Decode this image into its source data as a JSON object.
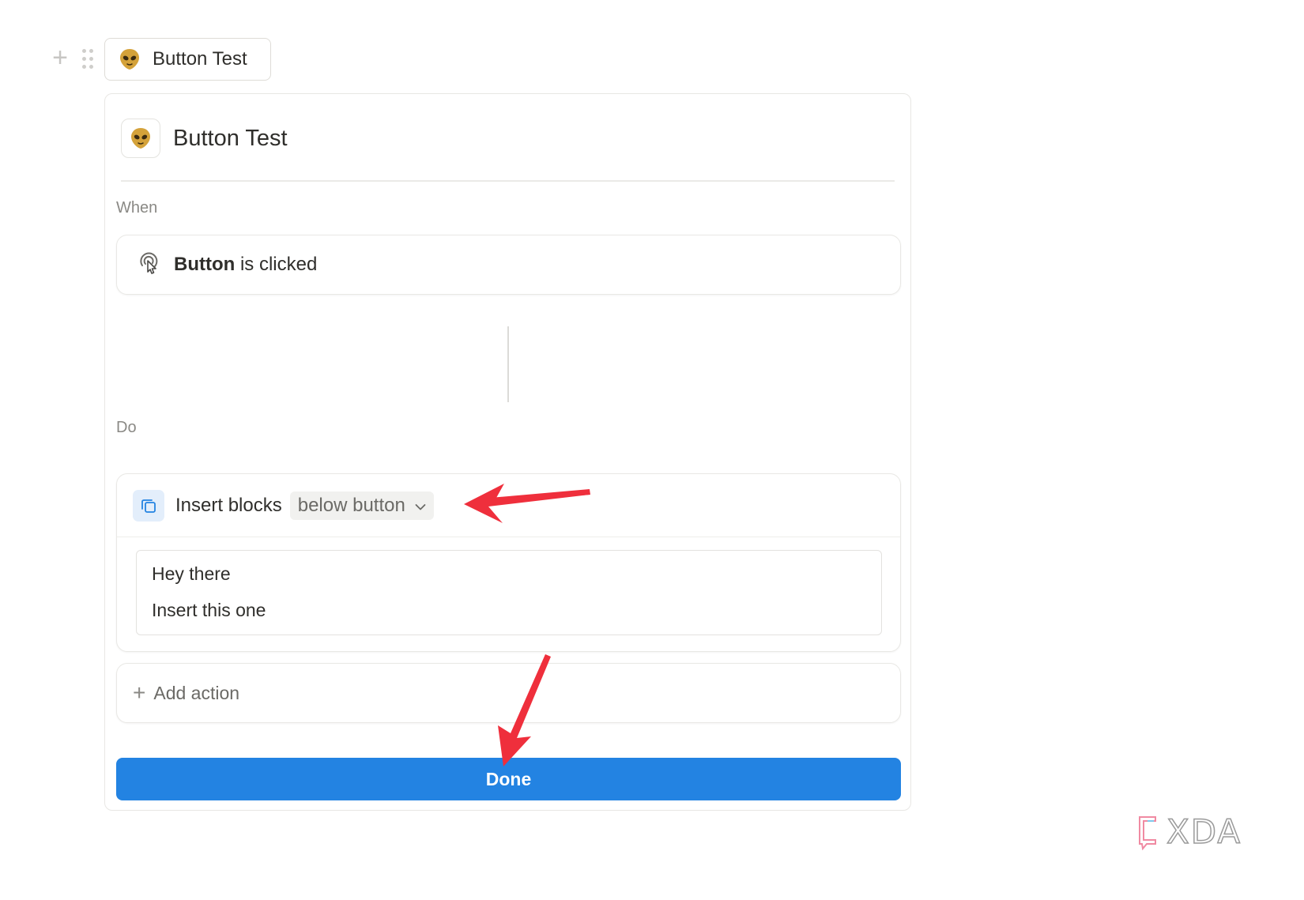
{
  "block_chip": {
    "label": "Button Test",
    "icon": "alien-emoji-icon"
  },
  "editor": {
    "title": "Button Test",
    "title_icon": "alien-emoji-icon",
    "when_label": "When",
    "trigger": {
      "bold": "Button",
      "rest": " is clicked",
      "icon": "cursor-click-icon"
    },
    "do_label": "Do",
    "action": {
      "name": "Insert blocks",
      "position": "below button",
      "icon": "copy-icon",
      "blocks": [
        "Hey there",
        "Insert this one"
      ]
    },
    "add_action_label": "Add action",
    "done_label": "Done"
  },
  "colors": {
    "accent": "#2383e2",
    "annotation_arrow": "#ef2f3c"
  },
  "watermark": {
    "text": "XDA"
  }
}
